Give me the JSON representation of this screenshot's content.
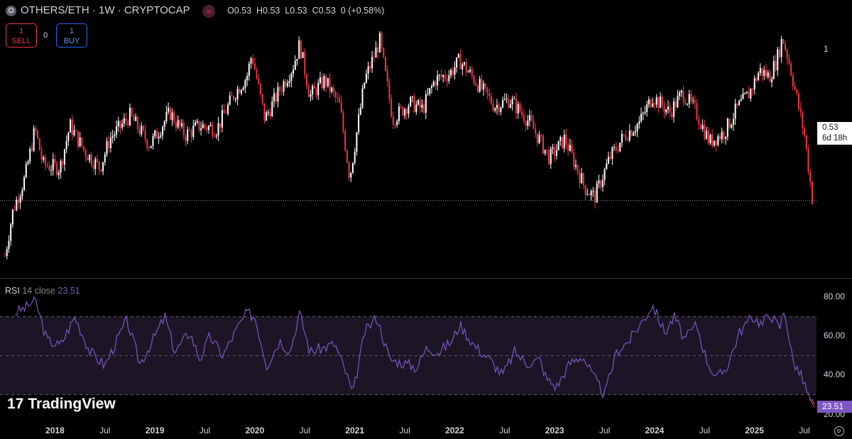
{
  "header": {
    "symbol_icon": "O",
    "title": "OTHERS/ETH · 1W · CRYPTOCAP",
    "indicator_icon": "≈",
    "ohlc": {
      "open": "O0.53",
      "high": "H0.53",
      "low": "L0.53",
      "close": "C0.53",
      "change": "0 (+0.58%)"
    }
  },
  "trade": {
    "sell_price": "1",
    "sell_label": "SELL",
    "spread": "0",
    "buy_price": "1",
    "buy_label": "BUY"
  },
  "price_axis": {
    "tick_1": "1",
    "last_price": "0.53",
    "countdown": "6d 18h"
  },
  "rsi": {
    "name": "RSI",
    "params": "14 close",
    "value": "23.51",
    "ticks": [
      "80.00",
      "60.00",
      "40.00",
      "20.00"
    ]
  },
  "x_axis": [
    {
      "label": "2018",
      "year": true,
      "t": 2018.0
    },
    {
      "label": "Jul",
      "year": false,
      "t": 2018.5
    },
    {
      "label": "2019",
      "year": true,
      "t": 2019.0
    },
    {
      "label": "Jul",
      "year": false,
      "t": 2019.5
    },
    {
      "label": "2020",
      "year": true,
      "t": 2020.0
    },
    {
      "label": "Jul",
      "year": false,
      "t": 2020.5
    },
    {
      "label": "2021",
      "year": true,
      "t": 2021.0
    },
    {
      "label": "Jul",
      "year": false,
      "t": 2021.5
    },
    {
      "label": "2022",
      "year": true,
      "t": 2022.0
    },
    {
      "label": "Jul",
      "year": false,
      "t": 2022.5
    },
    {
      "label": "2023",
      "year": true,
      "t": 2023.0
    },
    {
      "label": "Jul",
      "year": false,
      "t": 2023.5
    },
    {
      "label": "2024",
      "year": true,
      "t": 2024.0
    },
    {
      "label": "Jul",
      "year": false,
      "t": 2024.5
    },
    {
      "label": "2025",
      "year": true,
      "t": 2025.0
    },
    {
      "label": "Jul",
      "year": false,
      "t": 2025.5
    }
  ],
  "branding": {
    "logo_text": "TradingView",
    "logo_mark": "17"
  },
  "colors": {
    "up": "#ffffff",
    "down": "#f23645",
    "rsi_line": "#7e57c2",
    "rsi_band": "#1c1526",
    "background": "#000000"
  },
  "chart_data": {
    "type": "candlestick",
    "timeframe": "1W",
    "x_range": [
      2017.45,
      2025.62
    ],
    "y_range_price": [
      0.34,
      1.08
    ],
    "y_range_rsi": [
      20,
      80
    ],
    "rsi_levels": [
      70,
      50,
      30
    ],
    "price_anchors": [
      [
        2017.5,
        0.36
      ],
      [
        2017.58,
        0.5
      ],
      [
        2017.7,
        0.6
      ],
      [
        2017.8,
        0.75
      ],
      [
        2017.88,
        0.64
      ],
      [
        2018.05,
        0.63
      ],
      [
        2018.15,
        0.76
      ],
      [
        2018.3,
        0.68
      ],
      [
        2018.45,
        0.63
      ],
      [
        2018.55,
        0.72
      ],
      [
        2018.75,
        0.79
      ],
      [
        2018.95,
        0.7
      ],
      [
        2019.15,
        0.8
      ],
      [
        2019.3,
        0.73
      ],
      [
        2019.45,
        0.76
      ],
      [
        2019.62,
        0.75
      ],
      [
        2019.8,
        0.86
      ],
      [
        2019.92,
        0.91
      ],
      [
        2019.97,
        0.98
      ],
      [
        2020.1,
        0.78
      ],
      [
        2020.25,
        0.87
      ],
      [
        2020.38,
        0.94
      ],
      [
        2020.45,
        1.01
      ],
      [
        2020.55,
        0.85
      ],
      [
        2020.7,
        0.9
      ],
      [
        2020.85,
        0.82
      ],
      [
        2020.95,
        0.6
      ],
      [
        2021.1,
        0.9
      ],
      [
        2021.25,
        1.02
      ],
      [
        2021.38,
        0.78
      ],
      [
        2021.55,
        0.83
      ],
      [
        2021.68,
        0.81
      ],
      [
        2021.8,
        0.9
      ],
      [
        2021.95,
        0.92
      ],
      [
        2022.05,
        0.96
      ],
      [
        2022.25,
        0.88
      ],
      [
        2022.4,
        0.82
      ],
      [
        2022.55,
        0.84
      ],
      [
        2022.75,
        0.77
      ],
      [
        2022.95,
        0.66
      ],
      [
        2023.1,
        0.72
      ],
      [
        2023.3,
        0.57
      ],
      [
        2023.4,
        0.54
      ],
      [
        2023.55,
        0.66
      ],
      [
        2023.7,
        0.73
      ],
      [
        2023.85,
        0.77
      ],
      [
        2023.98,
        0.85
      ],
      [
        2024.15,
        0.8
      ],
      [
        2024.28,
        0.86
      ],
      [
        2024.4,
        0.81
      ],
      [
        2024.55,
        0.71
      ],
      [
        2024.7,
        0.74
      ],
      [
        2024.82,
        0.81
      ],
      [
        2024.95,
        0.86
      ],
      [
        2025.05,
        0.93
      ],
      [
        2025.15,
        0.91
      ],
      [
        2025.22,
        0.96
      ],
      [
        2025.28,
        1.03
      ],
      [
        2025.35,
        0.95
      ],
      [
        2025.5,
        0.73
      ],
      [
        2025.58,
        0.53
      ]
    ],
    "rsi_anchors": [
      [
        2017.6,
        72
      ],
      [
        2017.72,
        75
      ],
      [
        2017.8,
        79
      ],
      [
        2017.92,
        58
      ],
      [
        2018.05,
        55
      ],
      [
        2018.2,
        70
      ],
      [
        2018.35,
        52
      ],
      [
        2018.5,
        45
      ],
      [
        2018.62,
        58
      ],
      [
        2018.72,
        68
      ],
      [
        2018.85,
        46
      ],
      [
        2018.95,
        55
      ],
      [
        2019.1,
        70
      ],
      [
        2019.2,
        52
      ],
      [
        2019.35,
        62
      ],
      [
        2019.45,
        48
      ],
      [
        2019.55,
        60
      ],
      [
        2019.68,
        50
      ],
      [
        2019.8,
        62
      ],
      [
        2019.92,
        72
      ],
      [
        2020.0,
        70
      ],
      [
        2020.12,
        45
      ],
      [
        2020.25,
        58
      ],
      [
        2020.35,
        52
      ],
      [
        2020.45,
        72
      ],
      [
        2020.55,
        52
      ],
      [
        2020.68,
        54
      ],
      [
        2020.8,
        56
      ],
      [
        2020.92,
        40
      ],
      [
        2020.98,
        30
      ],
      [
        2021.1,
        62
      ],
      [
        2021.22,
        70
      ],
      [
        2021.35,
        48
      ],
      [
        2021.5,
        46
      ],
      [
        2021.62,
        44
      ],
      [
        2021.72,
        54
      ],
      [
        2021.85,
        52
      ],
      [
        2021.98,
        58
      ],
      [
        2022.05,
        66
      ],
      [
        2022.2,
        55
      ],
      [
        2022.35,
        48
      ],
      [
        2022.48,
        40
      ],
      [
        2022.6,
        52
      ],
      [
        2022.72,
        46
      ],
      [
        2022.85,
        48
      ],
      [
        2022.92,
        38
      ],
      [
        2023.02,
        34
      ],
      [
        2023.15,
        46
      ],
      [
        2023.28,
        50
      ],
      [
        2023.4,
        38
      ],
      [
        2023.5,
        30
      ],
      [
        2023.62,
        52
      ],
      [
        2023.75,
        58
      ],
      [
        2023.88,
        68
      ],
      [
        2023.98,
        76
      ],
      [
        2024.1,
        62
      ],
      [
        2024.2,
        70
      ],
      [
        2024.3,
        58
      ],
      [
        2024.42,
        66
      ],
      [
        2024.52,
        48
      ],
      [
        2024.62,
        38
      ],
      [
        2024.72,
        44
      ],
      [
        2024.85,
        62
      ],
      [
        2024.98,
        70
      ],
      [
        2025.08,
        66
      ],
      [
        2025.15,
        72
      ],
      [
        2025.25,
        64
      ],
      [
        2025.3,
        74
      ],
      [
        2025.38,
        48
      ],
      [
        2025.48,
        38
      ],
      [
        2025.55,
        28
      ],
      [
        2025.6,
        23.51
      ]
    ]
  }
}
